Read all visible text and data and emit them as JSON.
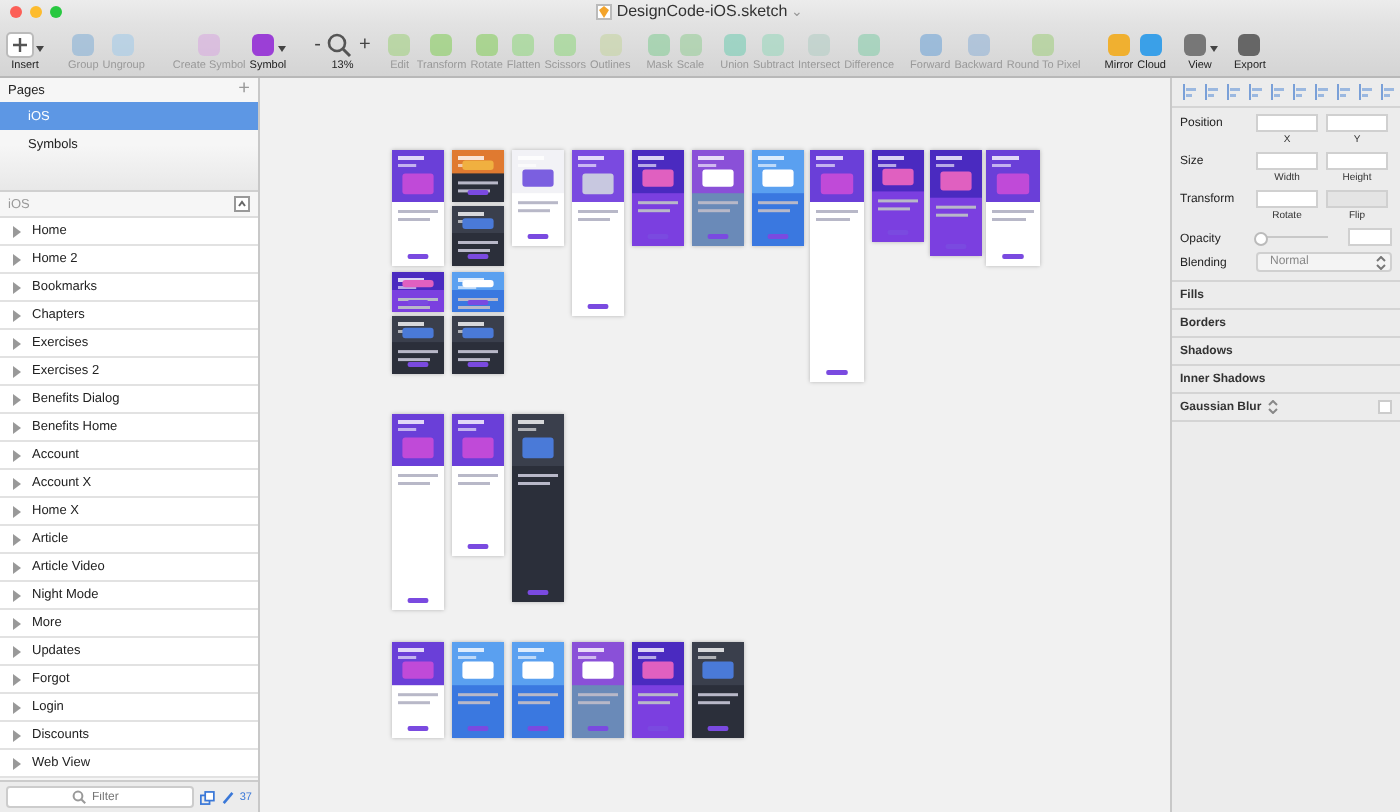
{
  "window": {
    "title": "DesignCode-iOS.sketch",
    "title_caret": "⌄"
  },
  "toolbar": [
    [
      {
        "label": "Insert",
        "kind": "dropdown",
        "disabled": false
      }
    ],
    [
      {
        "label": "Group",
        "kind": "button",
        "disabled": true
      },
      {
        "label": "Ungroup",
        "kind": "button",
        "disabled": true
      }
    ],
    [
      {
        "label": "Create Symbol",
        "kind": "button",
        "disabled": true
      },
      {
        "label": "Symbol",
        "kind": "dropdown",
        "disabled": false
      }
    ],
    [
      {
        "label": "13%",
        "kind": "zoom",
        "minus": "-",
        "plus": "+",
        "disabled": false
      }
    ],
    [
      {
        "label": "Edit",
        "kind": "button",
        "disabled": true
      },
      {
        "label": "Transform",
        "kind": "button",
        "disabled": true
      },
      {
        "label": "Rotate",
        "kind": "button",
        "disabled": true
      },
      {
        "label": "Flatten",
        "kind": "button",
        "disabled": true
      },
      {
        "label": "Scissors",
        "kind": "button",
        "disabled": true
      },
      {
        "label": "Outlines",
        "kind": "button",
        "disabled": true
      }
    ],
    [
      {
        "label": "Mask",
        "kind": "button",
        "disabled": true
      },
      {
        "label": "Scale",
        "kind": "button",
        "disabled": true
      }
    ],
    [
      {
        "label": "Union",
        "kind": "button",
        "disabled": true
      },
      {
        "label": "Subtract",
        "kind": "button",
        "disabled": true
      },
      {
        "label": "Intersect",
        "kind": "button",
        "disabled": true
      },
      {
        "label": "Difference",
        "kind": "button",
        "disabled": true
      }
    ],
    [
      {
        "label": "Forward",
        "kind": "button",
        "disabled": true
      },
      {
        "label": "Backward",
        "kind": "button",
        "disabled": true
      },
      {
        "label": "Round To Pixel",
        "kind": "button",
        "disabled": true
      }
    ],
    [
      {
        "label": "Mirror",
        "kind": "button",
        "disabled": false
      },
      {
        "label": "Cloud",
        "kind": "button",
        "disabled": false
      }
    ],
    [
      {
        "label": "View",
        "kind": "dropdown",
        "disabled": false
      }
    ],
    [
      {
        "label": "Export",
        "kind": "button",
        "disabled": false
      }
    ]
  ],
  "pages": {
    "title": "Pages",
    "add": "+",
    "items": [
      {
        "label": "iOS",
        "selected": true
      },
      {
        "label": "Symbols",
        "selected": false
      }
    ]
  },
  "layers": {
    "title": "iOS",
    "items": [
      {
        "label": "Home",
        "expanded": false
      },
      {
        "label": "Home 2",
        "expanded": false
      },
      {
        "label": "Bookmarks",
        "expanded": false
      },
      {
        "label": "Chapters",
        "expanded": false
      },
      {
        "label": "Exercises",
        "expanded": false
      },
      {
        "label": "Exercises 2",
        "expanded": false
      },
      {
        "label": "Benefits Dialog",
        "expanded": false
      },
      {
        "label": "Benefits Home",
        "expanded": false
      },
      {
        "label": "Account",
        "expanded": false
      },
      {
        "label": "Account X",
        "expanded": false
      },
      {
        "label": "Home X",
        "expanded": false
      },
      {
        "label": "Article",
        "expanded": false
      },
      {
        "label": "Article Video",
        "expanded": false
      },
      {
        "label": "Night Mode",
        "expanded": false
      },
      {
        "label": "More",
        "expanded": false
      },
      {
        "label": "Updates",
        "expanded": false
      },
      {
        "label": "Forgot",
        "expanded": false
      },
      {
        "label": "Login",
        "expanded": false
      },
      {
        "label": "Discounts",
        "expanded": false
      },
      {
        "label": "Web View",
        "expanded": false
      }
    ]
  },
  "filter": {
    "placeholder": "Filter",
    "count": "37"
  },
  "inspector": {
    "rows": [
      {
        "label": "Position",
        "fields": [
          {
            "caption": "X"
          },
          {
            "caption": "Y"
          }
        ]
      },
      {
        "label": "Size",
        "fields": [
          {
            "caption": "Width"
          },
          {
            "caption": "Height"
          }
        ]
      },
      {
        "label": "Transform",
        "fields": [
          {
            "caption": "Rotate"
          },
          {
            "caption": "Flip"
          }
        ]
      }
    ],
    "opacity": {
      "label": "Opacity",
      "level": 0
    },
    "blending": {
      "label": "Blending",
      "value": "Normal"
    },
    "sections": [
      {
        "label": "Fills"
      },
      {
        "label": "Borders"
      },
      {
        "label": "Shadows"
      },
      {
        "label": "Inner Shadows"
      },
      {
        "label": "Gaussian Blur",
        "checked": false
      }
    ]
  }
}
